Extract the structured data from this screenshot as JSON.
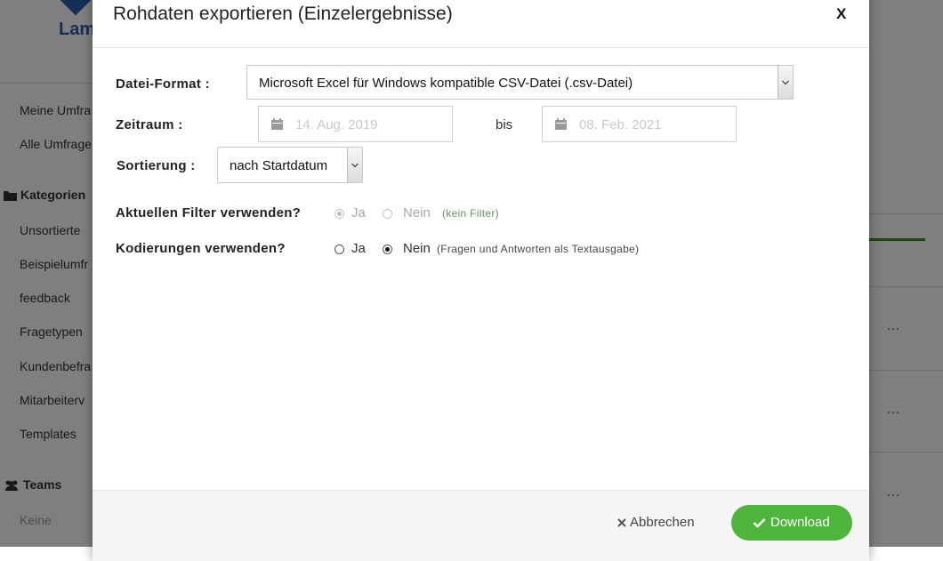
{
  "background": {
    "logo_text": "Lam",
    "sidebar_items": [
      "Meine Umfra",
      "Alle Umfrage"
    ],
    "categories_heading": "Kategorien",
    "category_items": [
      "Unsortierte",
      "Beispielumfr",
      "feedback",
      "Fragetypen",
      "Kundenbefra",
      "Mitarbeiterv",
      "Templates"
    ],
    "teams_heading": "Teams",
    "teams_empty": "Keine",
    "row_menu": "…"
  },
  "modal": {
    "title": "Rohdaten exportieren (Einzelergebnisse)",
    "close_label": "X",
    "format": {
      "label": "Datei-Format :",
      "value": "Microsoft Excel für Windows kompatible CSV-Datei (.csv-Datei)"
    },
    "period": {
      "label": "Zeitraum :",
      "from": "14. Aug. 2019",
      "separator": "bis",
      "to": "08. Feb. 2021"
    },
    "sort": {
      "label": "Sortierung :",
      "value": "nach Startdatum"
    },
    "filter": {
      "label": "Aktuellen Filter verwenden?",
      "yes": "Ja",
      "no": "Nein",
      "hint": "(kein Filter)",
      "selected": "yes",
      "disabled": true
    },
    "coding": {
      "label": "Kodierungen verwenden?",
      "yes": "Ja",
      "no": "Nein",
      "hint": "(Fragen und Antworten als Textausgabe)",
      "selected": "no"
    },
    "footer": {
      "cancel_label": "Abbrechen",
      "download_label": "Download"
    }
  },
  "colors": {
    "download_button": "#4db53b",
    "overlay": "rgba(0,0,0,0.5)",
    "brand_blue": "#2a5da8"
  }
}
